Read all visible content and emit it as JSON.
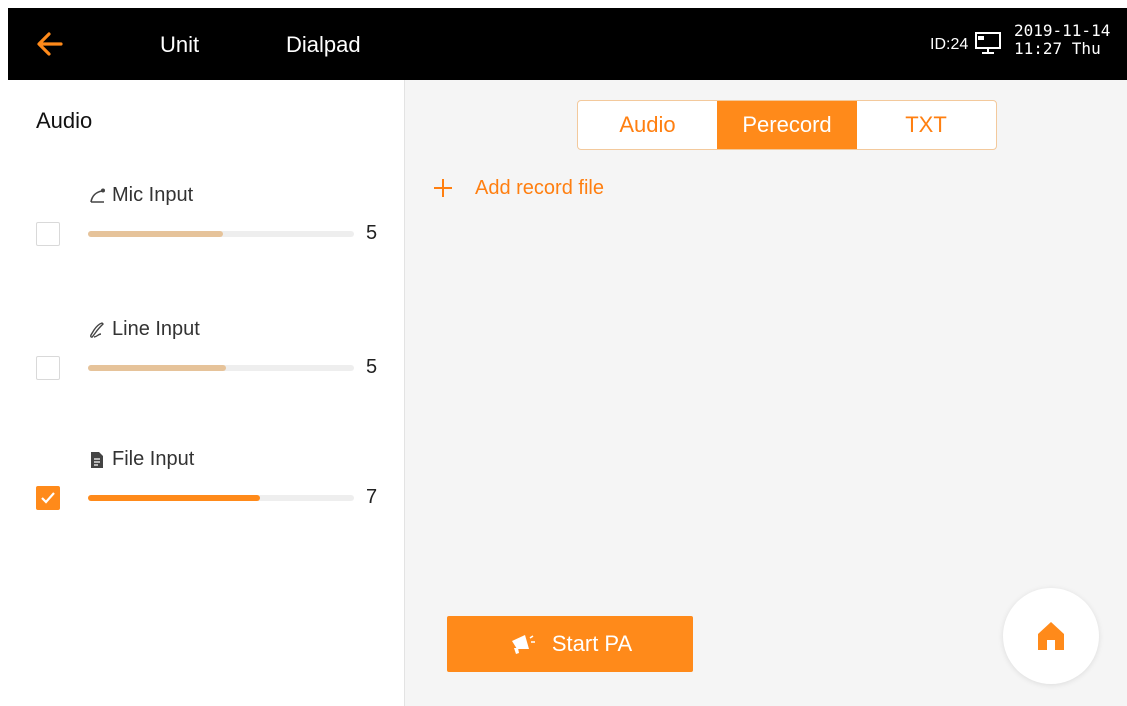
{
  "header": {
    "nav_unit": "Unit",
    "nav_dialpad": "Dialpad",
    "device_id": "ID:24",
    "date": "2019-11-14",
    "time_day": "11:27 Thu",
    "icons": {
      "back": "arrow-left-icon",
      "monitor": "monitor-icon"
    }
  },
  "sidebar": {
    "title": "Audio",
    "channels": [
      {
        "label": "Mic Input",
        "icon": "mic-icon",
        "checked": false,
        "value": "5",
        "level": 0.5
      },
      {
        "label": "Line Input",
        "icon": "line-input-icon",
        "checked": false,
        "value": "5",
        "level": 0.5
      },
      {
        "label": "File Input",
        "icon": "file-icon",
        "checked": true,
        "value": "7",
        "level": 0.7
      }
    ]
  },
  "main": {
    "tabs": [
      {
        "label": "Audio",
        "active": false
      },
      {
        "label": "Perecord",
        "active": true
      },
      {
        "label": "TXT",
        "active": false
      }
    ],
    "add_file_label": "Add record file",
    "start_button_label": "Start PA"
  },
  "colors": {
    "accent": "#ff8a1a",
    "slider_inactive": "#e6c39a",
    "topbar": "#000000"
  }
}
